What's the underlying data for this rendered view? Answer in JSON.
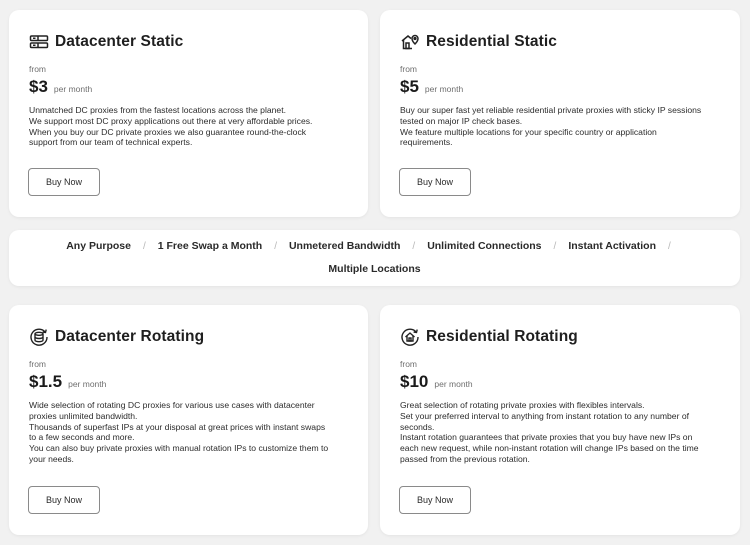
{
  "plans": [
    {
      "icon": "server-icon",
      "title": "Datacenter Static",
      "from_label": "from",
      "price": "$3",
      "per_month": "per month",
      "description": [
        "Unmatched DC proxies from the fastest locations across the planet.",
        "We support most DC proxy applications out there at very affordable prices.",
        "When you buy our DC private proxies we also guarantee round-the-clock",
        "support from our team of technical experts."
      ],
      "button_label": "Buy Now"
    },
    {
      "icon": "house-pin-icon",
      "title": "Residential Static",
      "from_label": "from",
      "price": "$5",
      "per_month": "per month",
      "description": [
        "Buy our super fast yet reliable residential private proxies with sticky IP sessions",
        "tested on major IP check bases.",
        "We feature multiple locations for your specific country or application",
        "requirements."
      ],
      "button_label": "Buy Now"
    },
    {
      "icon": "database-rotate-icon",
      "title": "Datacenter Rotating",
      "from_label": "from",
      "price": "$1.5",
      "per_month": "per month",
      "description": [
        "Wide selection of rotating DC proxies for various use cases with datacenter",
        "proxies unlimited bandwidth.",
        "Thousands of superfast IPs at your disposal at great prices with instant swaps",
        "to a few seconds and more.",
        "You can also buy private proxies with manual rotation IPs to customize them to",
        "your needs."
      ],
      "button_label": "Buy Now"
    },
    {
      "icon": "house-rotate-icon",
      "title": "Residential Rotating",
      "from_label": "from",
      "price": "$10",
      "per_month": "per month",
      "description": [
        "Great selection of rotating private proxies with flexibles intervals.",
        "Set your preferred interval to anything from instant rotation to any number of",
        "seconds.",
        "Instant rotation guarantees that private proxies that you buy have new IPs on",
        "each new request, while non-instant rotation will change IPs based on the time",
        "passed from the previous rotation."
      ],
      "button_label": "Buy Now"
    }
  ],
  "features": {
    "separator": "/",
    "items": [
      "Any Purpose",
      "1 Free Swap a Month",
      "Unmetered Bandwidth",
      "Unlimited Connections",
      "Instant Activation",
      "Multiple Locations"
    ]
  },
  "colors": {
    "page_background": "#f1f1f1",
    "card_background": "#ffffff",
    "text": "#1f1f1f",
    "muted_text": "#6f6f6f",
    "button_border": "#8a8a8a"
  }
}
